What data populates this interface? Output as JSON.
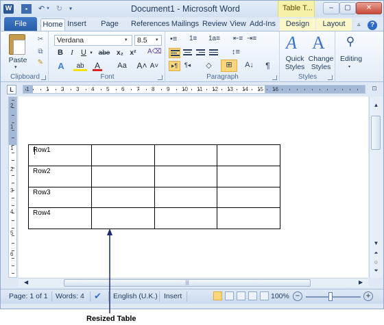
{
  "window": {
    "title": "Document1 - Microsoft Word",
    "context_tab_title": "Table T...",
    "app_icon": "W",
    "controls": {
      "minimize": "–",
      "maximize": "▢",
      "close": "✕"
    }
  },
  "qat": {
    "save": "▪",
    "undo": "↶",
    "undo_drop": "▾",
    "redo": "↻",
    "customize": "▾"
  },
  "tabs": {
    "file": "File",
    "home": "Home",
    "insert": "Insert",
    "page_layout": "Page Layout",
    "references": "References",
    "mailings": "Mailings",
    "review": "Review",
    "view": "View",
    "add_ins": "Add-Ins",
    "design": "Design",
    "layout": "Layout",
    "ribbon_min": "▵",
    "help": "?"
  },
  "ribbon": {
    "clipboard": {
      "label": "Clipboard",
      "paste_label": "Paste",
      "paste_drop": "▾",
      "cut_glyph": "✂",
      "copy_glyph": "⧉",
      "painter_glyph": "✎"
    },
    "font": {
      "label": "Font",
      "font_name": "Verdana",
      "font_size": "8.5",
      "arrow": "▾",
      "bold": "B",
      "italic": "I",
      "underline": "U",
      "strike": "abe",
      "subscript": "x₂",
      "superscript": "x²",
      "clear": "A⌫",
      "effects": "A",
      "highlight": "ab",
      "color": "A",
      "change_case": "Aa",
      "grow": "A˄",
      "shrink": "A˅"
    },
    "paragraph": {
      "label": "Paragraph",
      "bullets": "•≡",
      "numbering": "1≡",
      "multilevel": "1a≡",
      "decrease_indent": "⇤≡",
      "increase_indent": "⇥≡",
      "line_spacing": "↕≡",
      "ltr": "▸¶",
      "rtl": "¶◂",
      "shading": "◇",
      "borders": "⊞",
      "sort": "A↓",
      "pilcrow": "¶"
    },
    "styles": {
      "label": "Styles",
      "quick_styles": "Quick Styles",
      "change_styles": "Change Styles",
      "glyph": "A"
    },
    "editing": {
      "label": "Editing",
      "drop": "▾",
      "glyph": "⚲"
    }
  },
  "ruler": {
    "tab_selector": "L",
    "numbers": [
      "1",
      "2",
      "1",
      "2",
      "3",
      "4",
      "5",
      "6",
      "7",
      "8",
      "9",
      "10",
      "11",
      "12",
      "13",
      "14",
      "15",
      "16"
    ],
    "vertical_numbers": [
      "2",
      "1",
      "1",
      "2",
      "3",
      "4",
      "5",
      "6"
    ],
    "view_icon": "⊡"
  },
  "document": {
    "table": {
      "rows": [
        [
          "Row1",
          "",
          "",
          ""
        ],
        [
          "Row2",
          "",
          "",
          ""
        ],
        [
          "Row3",
          "",
          "",
          ""
        ],
        [
          "Row4",
          "",
          "",
          ""
        ]
      ]
    }
  },
  "scrollbars": {
    "up": "▲",
    "down": "▼",
    "prev_page": "⏶",
    "browse": "○",
    "next_page": "⏷",
    "left": "◀",
    "right": "▶",
    "grip": "|||"
  },
  "statusbar": {
    "page": "Page: 1 of 1",
    "words": "Words: 4",
    "spell_icon": "✔",
    "language": "English (U.K.)",
    "insert_mode": "Insert",
    "zoom": "100%",
    "zoom_out": "−",
    "zoom_in": "+"
  },
  "annotation": {
    "label": "Resized Table"
  }
}
